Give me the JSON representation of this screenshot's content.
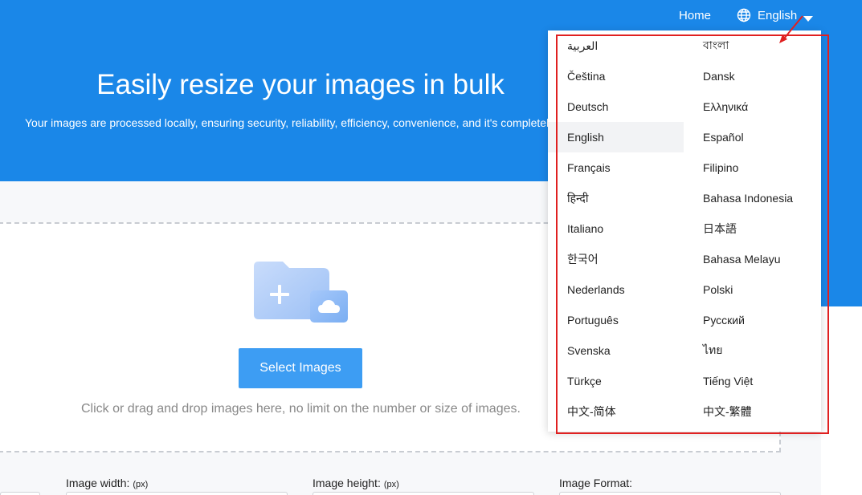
{
  "header": {
    "nav_home": "Home",
    "nav_language": "English",
    "title": "Easily resize your images in bulk",
    "subtitle": "Your images are processed locally, ensuring security, reliability, efficiency, convenience, and it's completely free"
  },
  "upload": {
    "select_button": "Select Images",
    "hint": "Click or drag and drop images here, no limit on the number or size of images."
  },
  "settings": {
    "width_label": "Image width:",
    "width_unit": "(px)",
    "height_label": "Image height:",
    "height_unit": "(px)",
    "format_label": "Image Format:"
  },
  "language_menu": {
    "selected": "English",
    "items": [
      "العربية",
      "বাংলা",
      "Čeština",
      "Dansk",
      "Deutsch",
      "Ελληνικά",
      "English",
      "Español",
      "Français",
      "Filipino",
      "हिन्दी",
      "Bahasa Indonesia",
      "Italiano",
      "日本語",
      "한국어",
      "Bahasa Melayu",
      "Nederlands",
      "Polski",
      "Português",
      "Русский",
      "Svenska",
      "ไทย",
      "Türkçe",
      "Tiếng Việt",
      "中文-简体",
      "中文-繁體"
    ]
  },
  "colors": {
    "hero_bg": "#1a87e8",
    "button_bg": "#3d9df3",
    "annotation": "#e02020"
  }
}
